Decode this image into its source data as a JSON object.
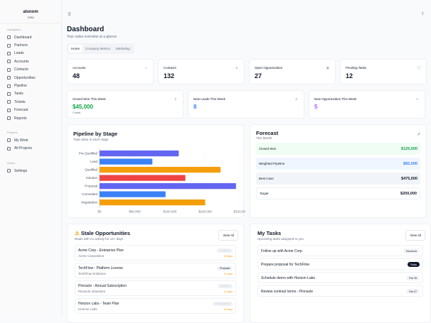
{
  "brand": {
    "name": "alonom",
    "sub": "CRM"
  },
  "sidebar": {
    "sections": [
      {
        "title": "Navigation",
        "items": [
          "Dashboard",
          "Partners",
          "Leads",
          "Accounts",
          "Contacts",
          "Opportunities",
          "Pipeline",
          "Tasks",
          "Tickets",
          "Forecast",
          "Reports"
        ]
      },
      {
        "title": "Projects",
        "items": [
          "My Work",
          "All Projects"
        ]
      },
      {
        "title": "Admin",
        "items": [
          "Settings"
        ]
      }
    ]
  },
  "header": {
    "title": "Dashboard",
    "subtitle": "Your sales overview at a glance"
  },
  "tabs": [
    {
      "label": "Home",
      "active": true
    },
    {
      "label": "Company Metrics"
    },
    {
      "label": "Marketing"
    }
  ],
  "stats": [
    {
      "label": "Accounts",
      "value": "48",
      "icon": "building-icon"
    },
    {
      "label": "Contacts",
      "value": "132",
      "icon": "users-icon"
    },
    {
      "label": "Open Opportunities",
      "value": "27",
      "icon": "target-icon"
    },
    {
      "label": "Pending Tasks",
      "value": "12",
      "icon": "checkbox-icon"
    }
  ],
  "weekly": [
    {
      "label": "Closed Won This Week",
      "value": "$45,000",
      "note": "3 deals",
      "color": "#16a34a",
      "icon": "trophy-icon"
    },
    {
      "label": "New Leads This Week",
      "value": "8",
      "color": "#3b82f6",
      "icon": "user-plus-icon"
    },
    {
      "label": "New Opportunities This Week",
      "value": "5",
      "color": "#a855f7",
      "icon": "rocket-icon"
    }
  ],
  "pipeline": {
    "title": "Pipeline by Stage",
    "subtitle": "Total value in each stage"
  },
  "chart_data": {
    "type": "bar",
    "orientation": "horizontal",
    "categories": [
      "Pre-Qualified",
      "Lead",
      "Qualified",
      "Solution",
      "Proposal",
      "Committed",
      "Negotiation"
    ],
    "values": [
      180000,
      120000,
      275000,
      195000,
      310000,
      150000,
      240000
    ],
    "colors": [
      "#6366f1",
      "#3b82f6",
      "#f59e0b",
      "#ef4444",
      "#6366f1",
      "#3b82f6",
      "#f59e0b"
    ],
    "xticks": [
      "$0",
      "$80,000",
      "$160,000",
      "$240,000",
      "$320,000"
    ],
    "xlim": [
      0,
      320000
    ],
    "grid": true
  },
  "forecast": {
    "title": "Forecast",
    "subtitle": "This Month",
    "rows": [
      {
        "label": "Closed Won",
        "value": "$125,000",
        "bg": "#f0fdf4",
        "color": "#16a34a"
      },
      {
        "label": "Weighted Pipeline",
        "value": "$82,500",
        "bg": "#eff6ff",
        "color": "#3b82f6"
      },
      {
        "label": "Best Case",
        "value": "$475,000",
        "bg": "#f1f5f9",
        "color": "#111827"
      },
      {
        "label": "Target",
        "value": "$200,000",
        "bg": "#ffffff",
        "color": "#111827"
      }
    ]
  },
  "stale": {
    "title": "Stale Opportunities",
    "subtitle": "Deals with no activity for 14+ days",
    "view_all": "View All",
    "items": [
      {
        "name": "Acme Corp - Enterprise Plan",
        "company": "Acme Corporation",
        "stage": "Qualified",
        "days": "28 days"
      },
      {
        "name": "TechFlow - Platform License",
        "company": "TechFlow Solutions",
        "stage": "Proposal",
        "days": "21 days"
      },
      {
        "name": "Pinnacle - Annual Subscription",
        "company": "Pinnacle Industries",
        "stage": "Solution",
        "days": "18 days"
      },
      {
        "name": "Horizon Labs - Team Plan",
        "company": "Horizon Labs",
        "stage": "Pre-Qualified",
        "days": "16 days"
      }
    ]
  },
  "tasks": {
    "title": "My Tasks",
    "subtitle": "Upcoming tasks assigned to you",
    "view_all": "View All",
    "items": [
      {
        "title": "Follow up with Acme Corp",
        "due": "Tomorrow"
      },
      {
        "title": "Prepare proposal for TechFlow",
        "due": "Today"
      },
      {
        "title": "Schedule demo with Horizon Labs",
        "due": "Feb 25"
      },
      {
        "title": "Review contract terms - Pinnacle",
        "due": "Feb 27"
      }
    ]
  }
}
